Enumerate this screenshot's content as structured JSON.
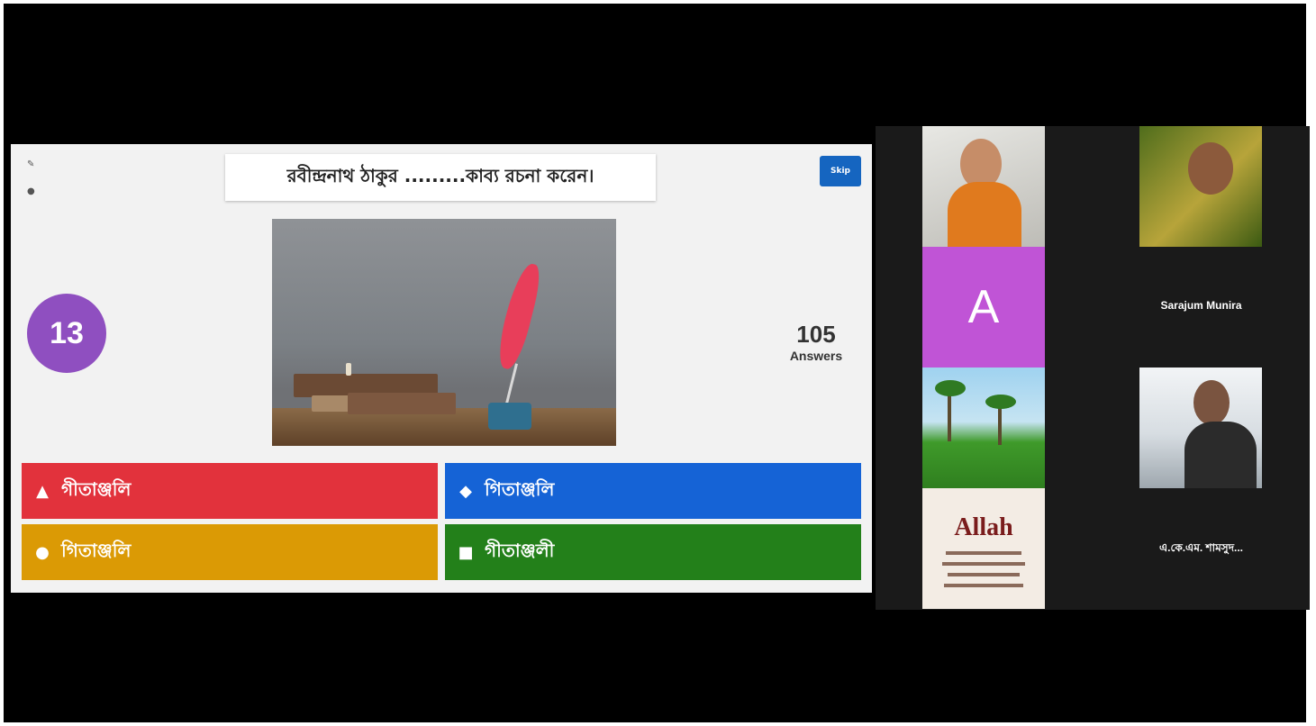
{
  "quiz": {
    "question": "রবীন্দ্রনাথ ঠাকুর .........কাব্য রচনা করেন।",
    "skip_label": "Skip",
    "timer": "13",
    "answers_count": "105",
    "answers_label": "Answers",
    "options": [
      {
        "label": "গীতাঞ্জলি",
        "shape": "triangle",
        "color": "#e2323c"
      },
      {
        "label": "গিতাঞ্জলি",
        "shape": "diamond",
        "color": "#1563d6"
      },
      {
        "label": "গিতাঞ্জলি",
        "shape": "circle",
        "color": "#db9a05"
      },
      {
        "label": "গীতাঞ্জলী",
        "shape": "square",
        "color": "#23801a"
      }
    ],
    "icons": [
      "pencil-icon",
      "eye-icon"
    ]
  },
  "gallery": {
    "participants": [
      {
        "name": "",
        "type": "video"
      },
      {
        "name": "",
        "type": "video"
      },
      {
        "name": "",
        "type": "avatar",
        "avatar_letter": "A"
      },
      {
        "name": "Sarajum Munira",
        "type": "name-only"
      },
      {
        "name": "",
        "type": "video"
      },
      {
        "name": "",
        "type": "video"
      },
      {
        "name": "",
        "type": "video",
        "overlay_text": "Allah"
      },
      {
        "name": "এ.কে.এম. শামসুদ...",
        "type": "name-only"
      }
    ]
  }
}
